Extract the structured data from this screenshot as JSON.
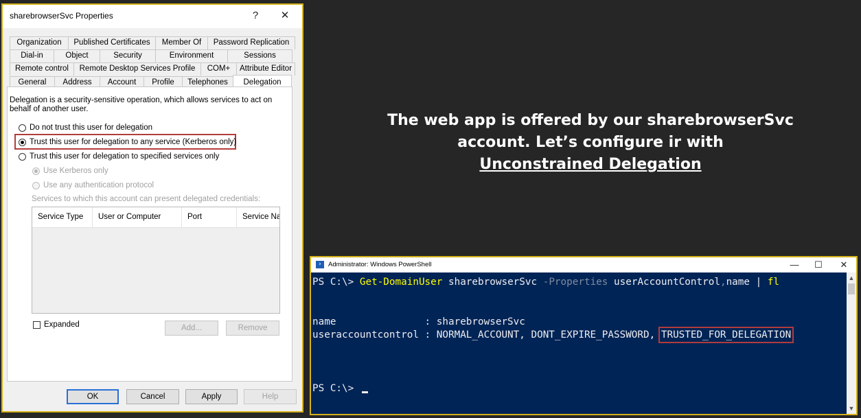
{
  "dialog": {
    "title": "sharebrowserSvc Properties",
    "help_glyph": "?",
    "close_glyph": "✕",
    "tab_rows": [
      [
        "Organization",
        "Published Certificates",
        "Member Of",
        "Password Replication"
      ],
      [
        "Dial-in",
        "Object",
        "Security",
        "Environment",
        "Sessions"
      ],
      [
        "Remote control",
        "Remote Desktop Services Profile",
        "COM+",
        "Attribute Editor"
      ],
      [
        "General",
        "Address",
        "Account",
        "Profile",
        "Telephones",
        "Delegation"
      ]
    ],
    "active_tab": "Delegation",
    "description": "Delegation is a security-sensitive operation, which allows services to act on behalf of another user.",
    "options": [
      {
        "label": "Do not trust this user for delegation",
        "selected": false
      },
      {
        "label": "Trust this user for delegation to any service (Kerberos only)",
        "selected": true
      },
      {
        "label": "Trust this user for delegation to specified services only",
        "selected": false
      }
    ],
    "sub_options": [
      {
        "label": "Use Kerberos only",
        "selected": true
      },
      {
        "label": "Use any authentication protocol",
        "selected": false
      }
    ],
    "services_label": "Services to which this account can present delegated credentials:",
    "list_columns": [
      "Service Type",
      "User or Computer",
      "Port",
      "Service Na"
    ],
    "expanded_label": "Expanded",
    "add_label": "Add...",
    "remove_label": "Remove",
    "ok_label": "OK",
    "cancel_label": "Cancel",
    "apply_label": "Apply",
    "help_label": "Help",
    "highlight_color": "#b23c3c"
  },
  "caption": {
    "line1": "The web app is offered by our sharebrowserSvc",
    "line2": "account. Let’s configure ir with",
    "line3": "Unconstrained Delegation"
  },
  "powershell": {
    "title": "Administrator: Windows PowerShell",
    "minimize_glyph": "—",
    "maximize_glyph": "☐",
    "close_glyph": "✕",
    "prompt": "PS C:\\> ",
    "cmd": "Get-DomainUser",
    "arg1": " sharebrowserSvc ",
    "param": "-Properties",
    "arg2": " userAccountControl",
    "comma": ",",
    "arg3": "name",
    "pipe": " | ",
    "fl": "fl",
    "out_name_key": "name               : ",
    "out_name_val": "sharebrowserSvc",
    "out_uac_key": "useraccountcontrol : ",
    "out_uac_val": "NORMAL_ACCOUNT, DONT_EXPIRE_PASSWORD, ",
    "out_uac_flag": "TRUSTED_FOR_DELEGATION",
    "prompt2": "PS C:\\> ",
    "colors": {
      "background": "#012456",
      "command": "#ffff00",
      "parameter": "#7f8c9f",
      "text": "#eeedf0"
    }
  }
}
